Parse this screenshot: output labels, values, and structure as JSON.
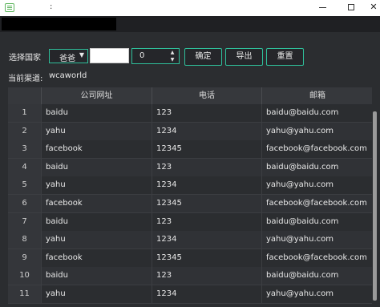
{
  "window": {
    "title": ":",
    "controls": {
      "minimize": "minimize-icon",
      "maximize": "maximize-icon",
      "close": "✕"
    }
  },
  "toolbar": {
    "country_label": "选择国家",
    "country_select": "爸爸",
    "text_input_value": "",
    "spin_value": "0",
    "confirm_label": "确定",
    "export_label": "导出",
    "reset_label": "重置"
  },
  "channel": {
    "label": "当前渠道:",
    "value": "wcaworld"
  },
  "table": {
    "columns": [
      "",
      "公司网址",
      "电话",
      "邮箱"
    ],
    "rows": [
      [
        "1",
        "baidu",
        "123",
        "baidu@baidu.com"
      ],
      [
        "2",
        "yahu",
        "1234",
        "yahu@yahu.com"
      ],
      [
        "3",
        "facebook",
        "12345",
        "facebook@facebook.com"
      ],
      [
        "4",
        "baidu",
        "123",
        "baidu@baidu.com"
      ],
      [
        "5",
        "yahu",
        "1234",
        "yahu@yahu.com"
      ],
      [
        "6",
        "facebook",
        "12345",
        "facebook@facebook.com"
      ],
      [
        "7",
        "baidu",
        "123",
        "baidu@baidu.com"
      ],
      [
        "8",
        "yahu",
        "1234",
        "yahu@yahu.com"
      ],
      [
        "9",
        "facebook",
        "12345",
        "facebook@facebook.com"
      ],
      [
        "10",
        "baidu",
        "123",
        "baidu@baidu.com"
      ],
      [
        "11",
        "yahu",
        "1234",
        "yahu@yahu.com"
      ]
    ]
  },
  "colors": {
    "accent": "#2fbf9a",
    "background": "#2b2d30",
    "text": "#e8e8e8"
  }
}
